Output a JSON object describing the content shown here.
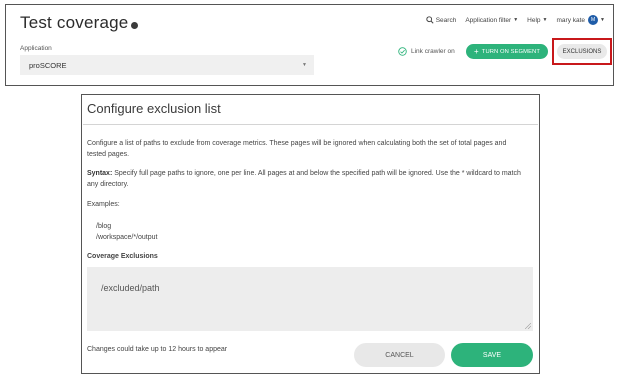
{
  "header": {
    "title": "Test coverage",
    "nav": {
      "search": "Search",
      "application_filter": "Application filter",
      "help": "Help",
      "user_name": "mary kate",
      "user_initials": "M"
    }
  },
  "application": {
    "label": "Application",
    "selected": "proSCORE"
  },
  "toolbar": {
    "link_crawler": "Link crawler on",
    "turn_on_segment": "TURN ON SEGMENT",
    "exclusions": "EXCLUSIONS"
  },
  "modal": {
    "title": "Configure exclusion list",
    "description": "Configure a list of paths to exclude from coverage metrics. These pages will be ignored when calculating both the set of total pages and tested pages.",
    "syntax_label": "Syntax:",
    "syntax_text": " Specify full page paths to ignore, one per line. All pages at and below the specified path will be ignored. Use the * wildcard to match any directory.",
    "examples_label": "Examples:",
    "examples": [
      "/blog",
      "/workspace/*/output"
    ],
    "coverage_label": "Coverage Exclusions",
    "coverage_value": "/excluded/path",
    "note": "Changes could take up to 12 hours to appear",
    "cancel": "CANCEL",
    "save": "SAVE"
  },
  "colors": {
    "accent_green": "#2db37b",
    "highlight_red": "#c8181b",
    "avatar_blue": "#1f5ca8"
  },
  "icons": [
    "info-icon",
    "search-icon",
    "caret-down-icon",
    "check-circle-icon",
    "plus-icon",
    "resize-grip-icon"
  ]
}
